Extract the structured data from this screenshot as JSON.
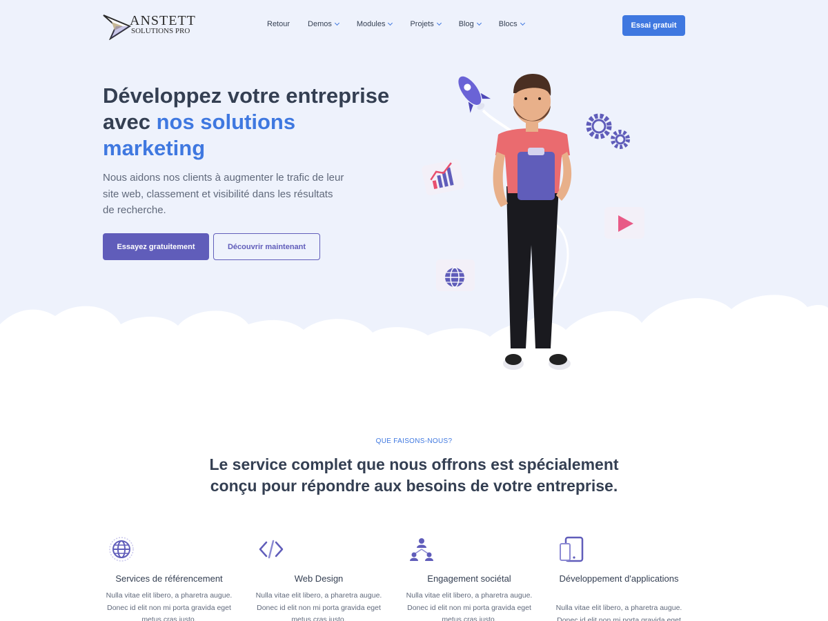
{
  "logo": {
    "name": "ANSTETT",
    "subtitle": "SOLUTIONS PRO"
  },
  "nav": {
    "items": [
      {
        "label": "Retour",
        "dropdown": false
      },
      {
        "label": "Demos",
        "dropdown": true
      },
      {
        "label": "Modules",
        "dropdown": true
      },
      {
        "label": "Projets",
        "dropdown": true
      },
      {
        "label": "Blog",
        "dropdown": true
      },
      {
        "label": "Blocs",
        "dropdown": true
      }
    ],
    "cta": "Essai gratuit"
  },
  "hero": {
    "title_part1": "Développez votre entreprise avec ",
    "title_accent": "nos solutions marketing",
    "description": "Nous aidons nos clients à augmenter le trafic de leur site web, classement et visibilité dans les résultats de recherche.",
    "primary_button": "Essayez gratuitement",
    "secondary_button": "Découvrir maintenant"
  },
  "services": {
    "eyebrow": "QUE FAISONS-NOUS?",
    "title": "Le service complet que nous offrons est spécialement conçu pour répondre aux besoins de votre entreprise.",
    "items": [
      {
        "icon": "globe-icon",
        "title": "Services de référencement",
        "text": "Nulla vitae elit libero, a pharetra augue. Donec id elit non mi porta gravida eget metus cras justo."
      },
      {
        "icon": "code-icon",
        "title": "Web Design",
        "text": "Nulla vitae elit libero, a pharetra augue. Donec id elit non mi porta gravida eget metus cras justo."
      },
      {
        "icon": "team-icon",
        "title": "Engagement sociétal",
        "text": "Nulla vitae elit libero, a pharetra augue. Donec id elit non mi porta gravida eget metus cras justo."
      },
      {
        "icon": "devices-icon",
        "title": "Développement d'applications",
        "text": "Nulla vitae elit libero, a pharetra augue. Donec id elit non mi porta gravida eget metus cras justo."
      }
    ]
  },
  "colors": {
    "primary": "#3f78e0",
    "violet": "#605dba",
    "hero_bg": "#eef2fc",
    "heading": "#343f52",
    "body": "#60697b"
  }
}
